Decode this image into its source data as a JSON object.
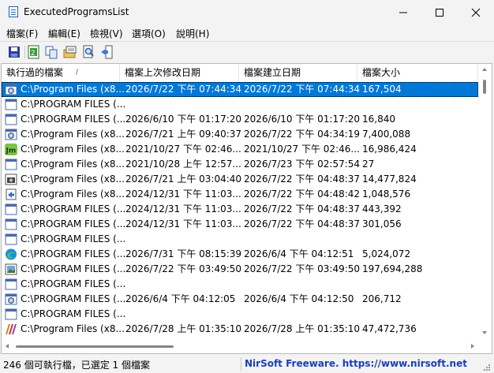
{
  "window": {
    "title": "ExecutedProgramsList"
  },
  "menu": [
    "檔案(F)",
    "編輯(E)",
    "檢視(V)",
    "選項(O)",
    "說明(H)"
  ],
  "toolbar": [
    {
      "name": "save-icon",
      "tooltip": ""
    },
    {
      "name": "refresh-icon",
      "tooltip": ""
    },
    {
      "name": "copy-icon",
      "tooltip": ""
    },
    {
      "name": "properties-icon",
      "tooltip": ""
    },
    {
      "name": "find-icon",
      "tooltip": ""
    },
    {
      "name": "exit-icon",
      "tooltip": ""
    }
  ],
  "columns": [
    "執行過的檔案",
    "檔案上次修改日期",
    "檔案建立日期",
    "檔案大小"
  ],
  "sort_indicator": "/",
  "rows": [
    {
      "icon": "gear-window",
      "file": "C:\\Program Files (x8...",
      "modified": "2026/7/22 下午 07:44:34",
      "created": "2026/7/22 下午 07:44:34",
      "size": "167,504",
      "selected": true
    },
    {
      "icon": "app-window",
      "file": "C:\\PROGRAM FILES (...",
      "modified": "",
      "created": "",
      "size": ""
    },
    {
      "icon": "app-window",
      "file": "C:\\PROGRAM FILES (...",
      "modified": "2026/6/10 下午 01:17:20",
      "created": "2026/6/10 下午 01:17:20",
      "size": "16,840"
    },
    {
      "icon": "gear-window",
      "file": "C:\\Program Files (x8...",
      "modified": "2026/7/21 上午 09:40:37",
      "created": "2026/7/22 下午 04:34:19",
      "size": "7,400,088"
    },
    {
      "icon": "jm-badge",
      "file": "C:\\Program Files (x8...",
      "modified": "2021/10/27 下午 02:46...",
      "created": "2021/10/27 下午 02:46...",
      "size": "16,986,424"
    },
    {
      "icon": "app-window",
      "file": "C:\\Program Files (x8...",
      "modified": "2021/10/28 上午 12:57...",
      "created": "2026/7/23 下午 02:57:54",
      "size": "27"
    },
    {
      "icon": "camera",
      "file": "C:\\Program Files (x8...",
      "modified": "2026/7/21 上午 03:04:40",
      "created": "2026/7/22 下午 04:48:37",
      "size": "14,477,824"
    },
    {
      "icon": "arrow-doc",
      "file": "C:\\Program Files (x8...",
      "modified": "2024/12/31 下午 11:03...",
      "created": "2026/7/22 下午 04:48:42",
      "size": "1,048,576"
    },
    {
      "icon": "app-window",
      "file": "C:\\PROGRAM FILES (...",
      "modified": "2024/12/31 下午 11:03...",
      "created": "2026/7/22 下午 04:48:37",
      "size": "443,392"
    },
    {
      "icon": "app-window",
      "file": "C:\\PROGRAM FILES (...",
      "modified": "2024/12/31 下午 11:03...",
      "created": "2026/7/22 下午 04:48:37",
      "size": "301,056"
    },
    {
      "icon": "app-window",
      "file": "C:\\PROGRAM FILES (...",
      "modified": "",
      "created": "",
      "size": ""
    },
    {
      "icon": "edge",
      "file": "C:\\PROGRAM FILES (...",
      "modified": "2026/7/31 下午 08:15:39",
      "created": "2026/6/4 下午 04:12:51",
      "size": "5,024,072"
    },
    {
      "icon": "photo",
      "file": "C:\\PROGRAM FILES (...",
      "modified": "2026/7/22 下午 03:49:50",
      "created": "2026/7/22 下午 03:49:50",
      "size": "197,694,288"
    },
    {
      "icon": "app-window",
      "file": "C:\\PROGRAM FILES (...",
      "modified": "",
      "created": "",
      "size": ""
    },
    {
      "icon": "gear-window",
      "file": "C:\\PROGRAM FILES (...",
      "modified": "2026/6/4 下午 04:12:05",
      "created": "2026/6/4 下午 04:12:50",
      "size": "206,712"
    },
    {
      "icon": "app-window",
      "file": "C:\\PROGRAM FILES (...",
      "modified": "",
      "created": "",
      "size": ""
    },
    {
      "icon": "stripes",
      "file": "C:\\Program Files (x8...",
      "modified": "2026/7/28 上午 01:35:10",
      "created": "2026/7/28 上午 01:35:10",
      "size": "47,472,736"
    }
  ],
  "status": {
    "left": "246 個可執行檔，已選定 1 個檔案",
    "right": "NirSoft Freeware. https://www.nirsoft.net"
  },
  "colors": {
    "selection": "#0078d7",
    "link": "#1a3fb5"
  }
}
